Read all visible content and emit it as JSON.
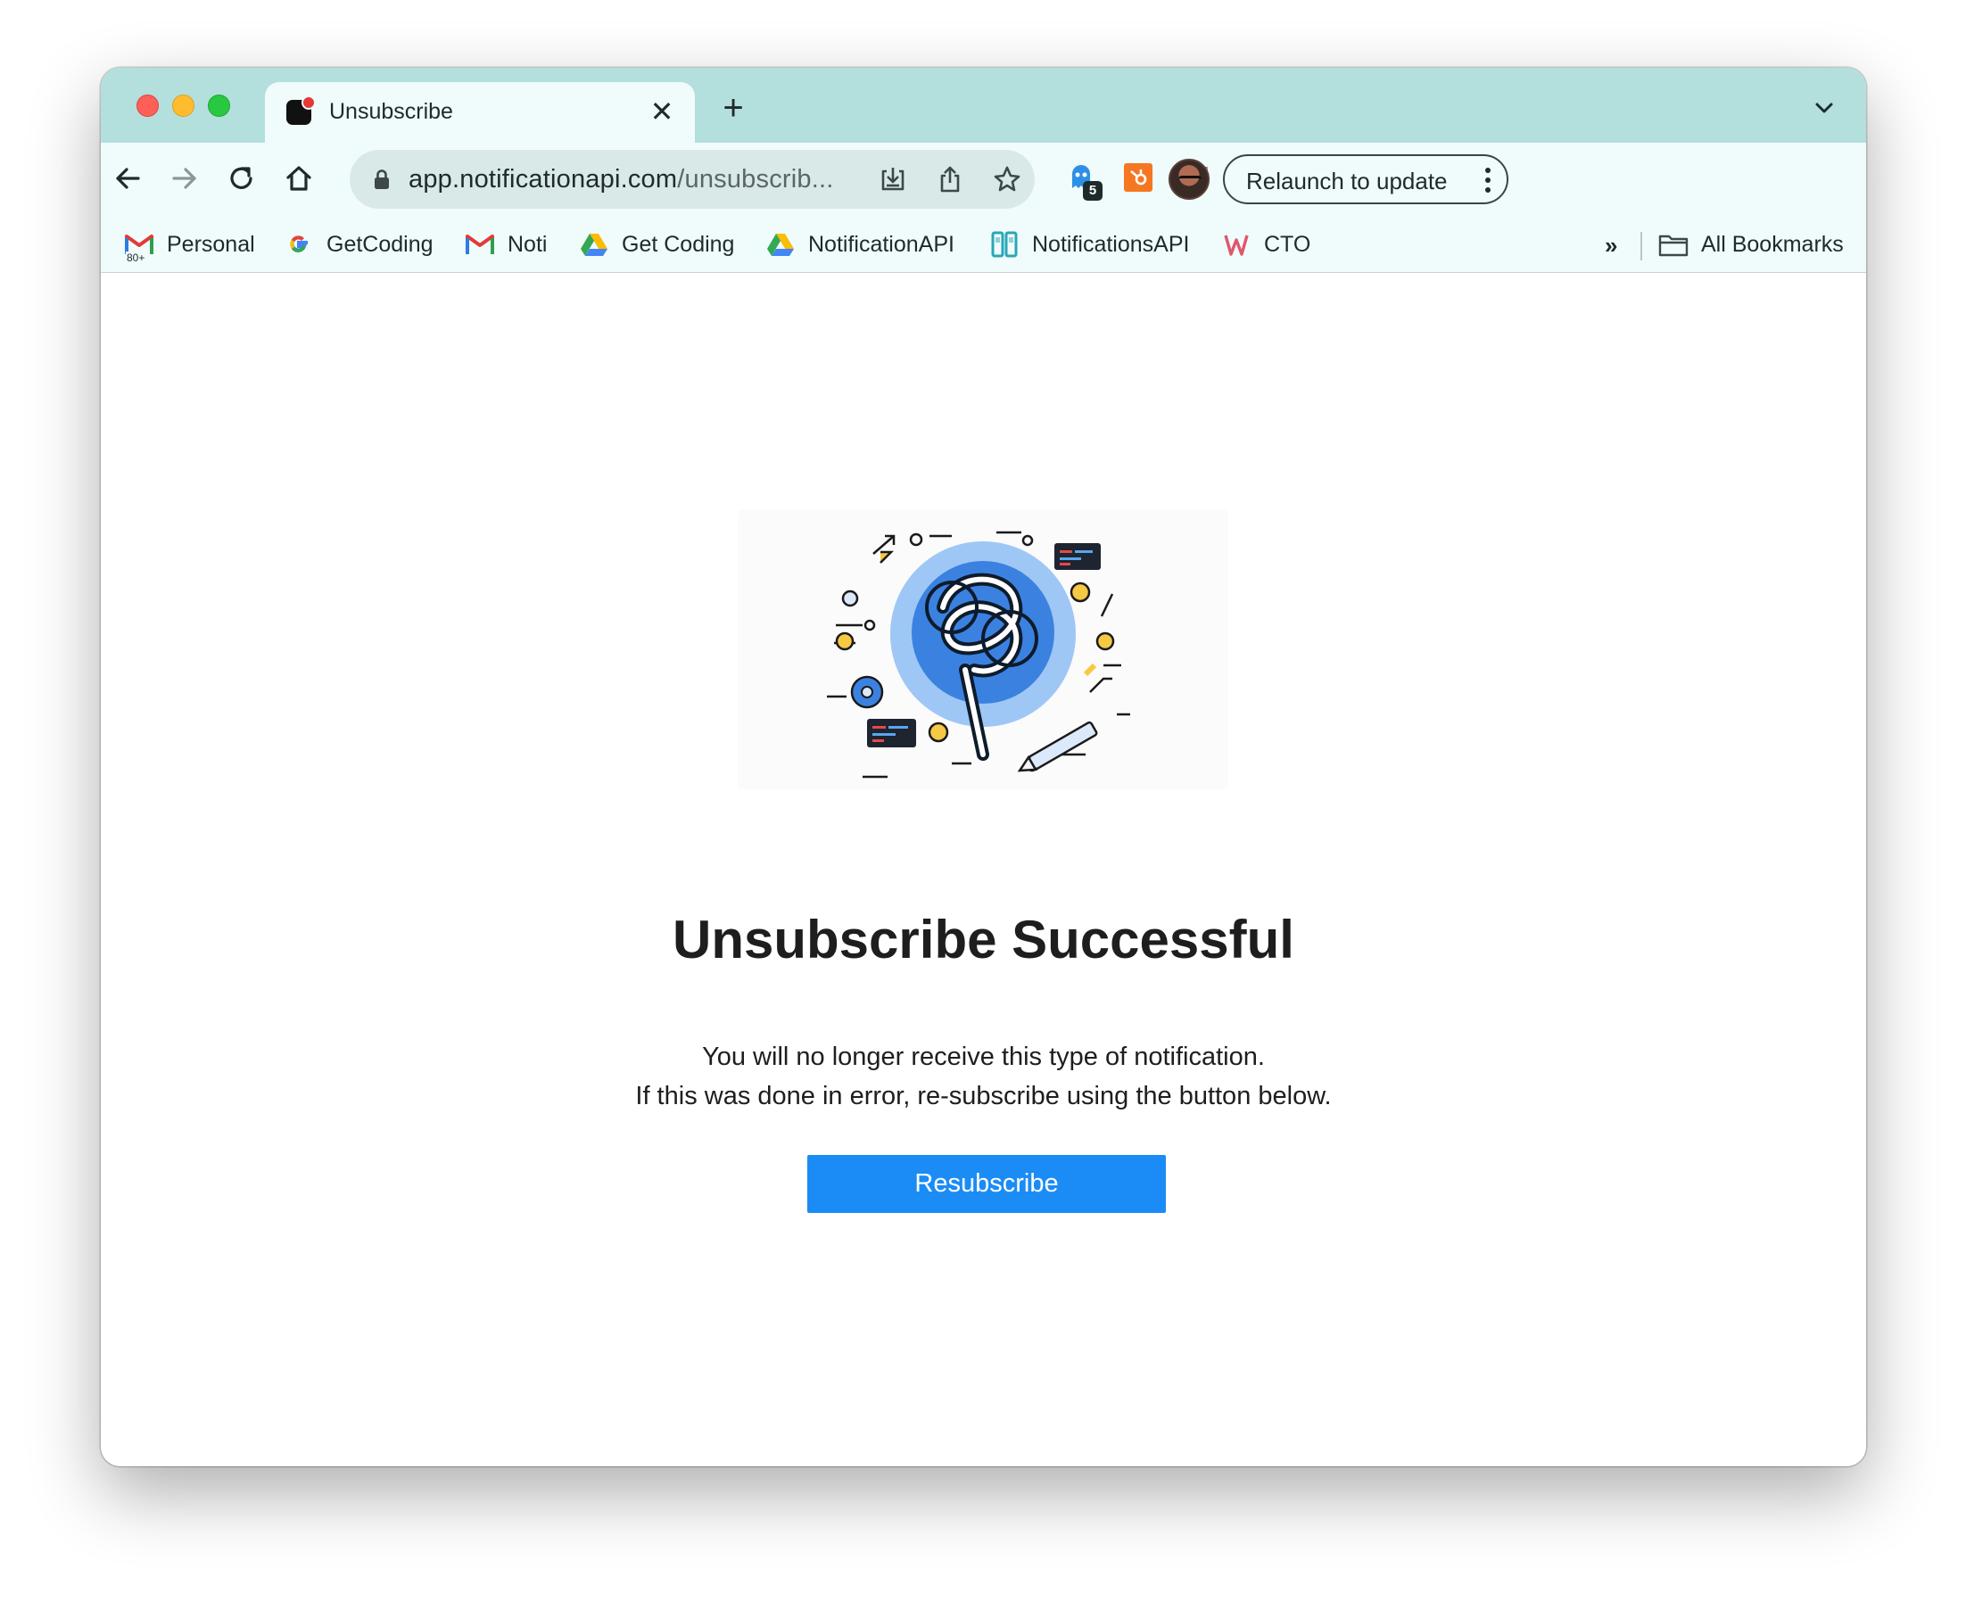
{
  "tab": {
    "title": "Unsubscribe",
    "close_glyph": "✕",
    "new_tab_glyph": "+"
  },
  "omnibox": {
    "host": "app.notificationapi.com",
    "path": "/unsubscrib..."
  },
  "extensions": {
    "ghostery_badge": "5"
  },
  "relaunch": {
    "label": "Relaunch to update"
  },
  "bookmarks": {
    "items": [
      {
        "label": "Personal",
        "icon": "gmail-icon",
        "badge": "80+"
      },
      {
        "label": "GetCoding",
        "icon": "google-icon"
      },
      {
        "label": "Noti",
        "icon": "gmail-icon"
      },
      {
        "label": "Get Coding",
        "icon": "google-drive-icon"
      },
      {
        "label": "NotificationAPI",
        "icon": "google-drive-icon"
      },
      {
        "label": "NotificationsAPI",
        "icon": "notificationsapi-icon"
      },
      {
        "label": "CTO",
        "icon": "cto-icon"
      }
    ],
    "more_glyph": "»",
    "all_bookmarks": "All Bookmarks"
  },
  "page": {
    "title": "Unsubscribe Successful",
    "line1": "You will no longer receive this type of notification.",
    "line2": "If this was done in error, re-subscribe using the button below.",
    "button_label": "Resubscribe"
  },
  "colors": {
    "tab_strip": "#b3dfdd",
    "toolbar": "#effcfb",
    "button": "#1b8cf5",
    "hero_blue": "#3b82e0"
  }
}
